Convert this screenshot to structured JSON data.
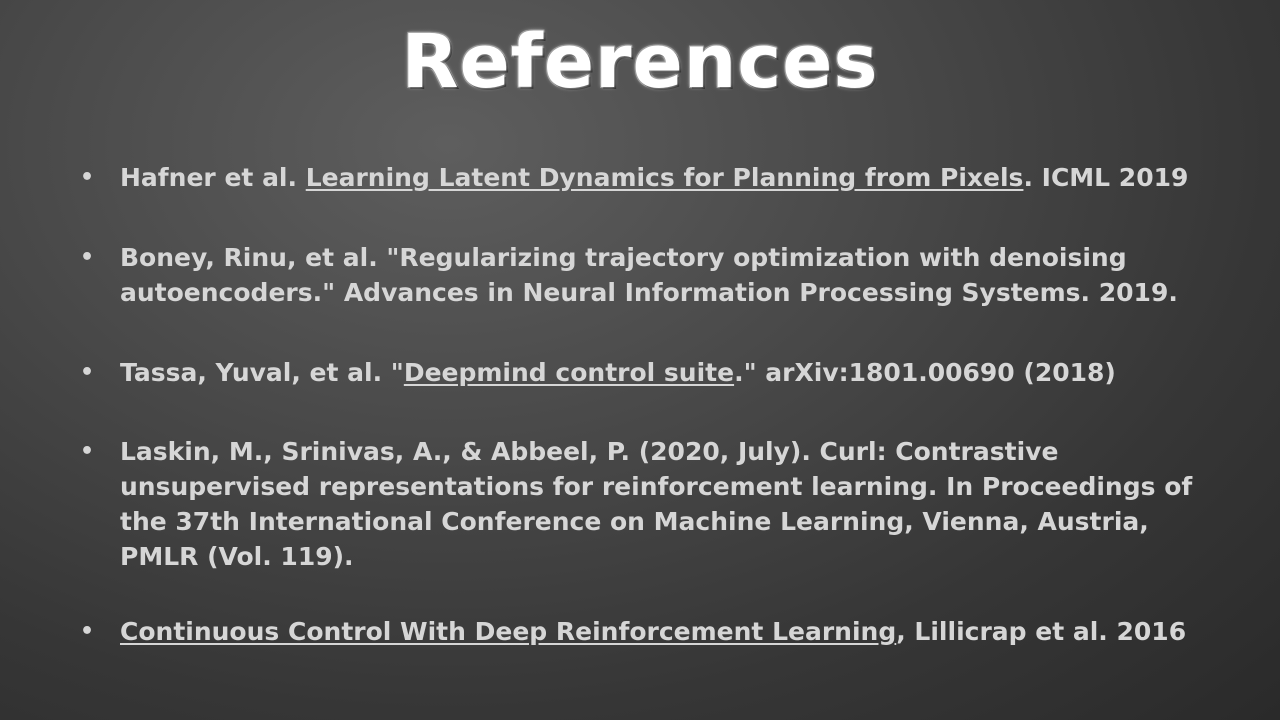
{
  "title": "References",
  "references": [
    {
      "before": "Hafner et al. ",
      "link": "Learning Latent Dynamics for Planning from Pixels",
      "after": ". ICML 2019"
    },
    {
      "before": "Boney, Rinu, et al. \"Regularizing trajectory optimization with denoising autoencoders.\" Advances in Neural Information Processing Systems. 2019.",
      "link": "",
      "after": ""
    },
    {
      "before": "Tassa, Yuval, et al. \"",
      "link": "Deepmind control suite",
      "after": ".\" arXiv:1801.00690 (2018)"
    },
    {
      "before": "Laskin, M., Srinivas, A., & Abbeel, P. (2020, July). Curl: Contrastive unsupervised representations for reinforcement learning. In Proceedings of the 37th International Conference on Machine Learning, Vienna, Austria, PMLR (Vol. 119).",
      "link": "",
      "after": ""
    },
    {
      "before": "",
      "link": "Continuous Control With Deep Reinforcement Learning",
      "after": ", Lillicrap et al. 2016"
    }
  ],
  "bullet": "•"
}
